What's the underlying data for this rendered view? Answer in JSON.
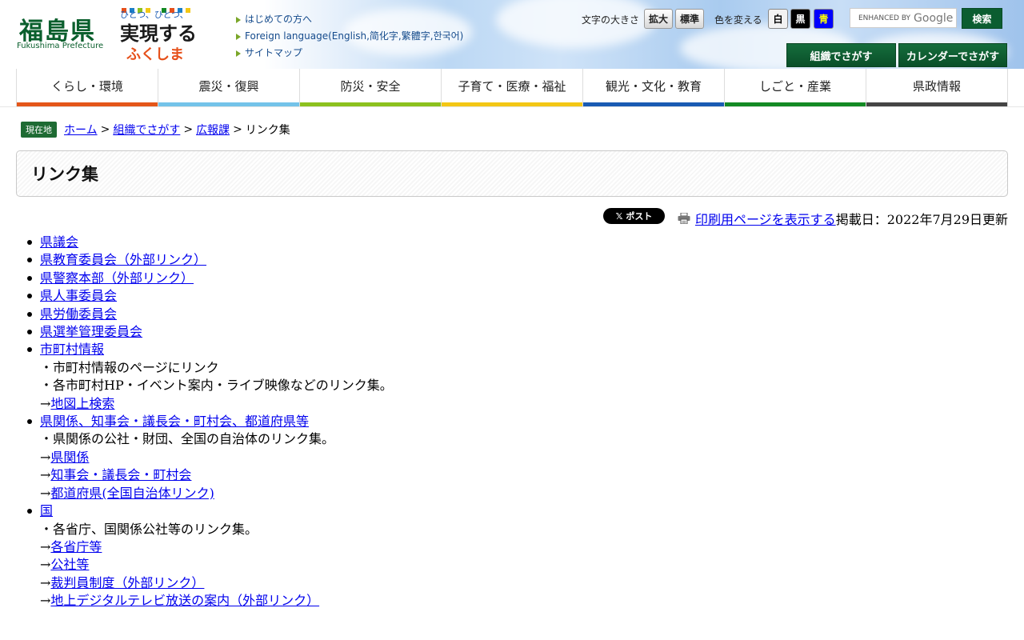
{
  "header": {
    "logo_text": "福島県",
    "logo_sub": "Fukushima Prefecture",
    "catch_lines": [
      "ひとつ、ひとつ、",
      "実現する",
      "ふくしま"
    ],
    "links": [
      "はじめての方へ",
      "Foreign language(English,简化字,繁體字,한국어)",
      "サイトマップ"
    ],
    "font_size_label": "文字の大きさ",
    "font_size_buttons": [
      "拡大",
      "標準"
    ],
    "color_label": "色を変える",
    "color_buttons": [
      {
        "label": "白",
        "bg": "#f2f2f2",
        "fg": "#000000"
      },
      {
        "label": "黒",
        "bg": "#000000",
        "fg": "#ffffff"
      },
      {
        "label": "青",
        "bg": "#0000ff",
        "fg": "#ffff00"
      }
    ],
    "search_placeholder_prefix": "ENHANCED BY",
    "search_placeholder_brand": "Google",
    "search_button": "検索",
    "org_search_button": "組織でさがす",
    "calendar_search_button": "カレンダーでさがす"
  },
  "nav": [
    {
      "label": "くらし・環境",
      "color": "#e4561a"
    },
    {
      "label": "震災・復興",
      "color": "#74c3e9"
    },
    {
      "label": "防災・安全",
      "color": "#8cc11e"
    },
    {
      "label": "子育て・医療・福祉",
      "color": "#f3c715"
    },
    {
      "label": "観光・文化・教育",
      "color": "#1a5bb3"
    },
    {
      "label": "しごと・産業",
      "color": "#138a24"
    },
    {
      "label": "県政情報",
      "color": "#444444"
    }
  ],
  "breadcrumb": {
    "badge": "現在地",
    "items": [
      "ホーム",
      "組織でさがす",
      "広報課"
    ],
    "separator": ">",
    "current": "リンク集"
  },
  "page_title": "リンク集",
  "tools": {
    "x_post": "𝕏 ポスト",
    "print_link": "印刷用ページを表示する",
    "updated": "掲載日：2022年7月29日更新"
  },
  "links": [
    {
      "label": "県議会"
    },
    {
      "label": "県教育委員会（外部リンク）"
    },
    {
      "label": "県警察本部（外部リンク）"
    },
    {
      "label": "県人事委員会"
    },
    {
      "label": "県労働委員会"
    },
    {
      "label": "県選挙管理委員会"
    },
    {
      "label": "市町村情報",
      "descs": [
        "・市町村情報のページにリンク",
        "・各市町村HP・イベント案内・ライブ映像などのリンク集。"
      ],
      "subs": [
        "地図上検索"
      ]
    },
    {
      "label": "県関係、知事会・議長会・町村会、都道府県等",
      "descs": [
        "・県関係の公社・財団、全国の自治体のリンク集。"
      ],
      "subs": [
        "県関係",
        "知事会・議長会・町村会",
        "都道府県(全国自治体リンク)"
      ]
    },
    {
      "label": "国",
      "descs": [
        "・各省庁、国関係公社等のリンク集。"
      ],
      "subs": [
        "各省庁等",
        "公社等",
        "裁判員制度（外部リンク）",
        "地上デジタルテレビ放送の案内（外部リンク）"
      ]
    }
  ],
  "arrow": "→"
}
